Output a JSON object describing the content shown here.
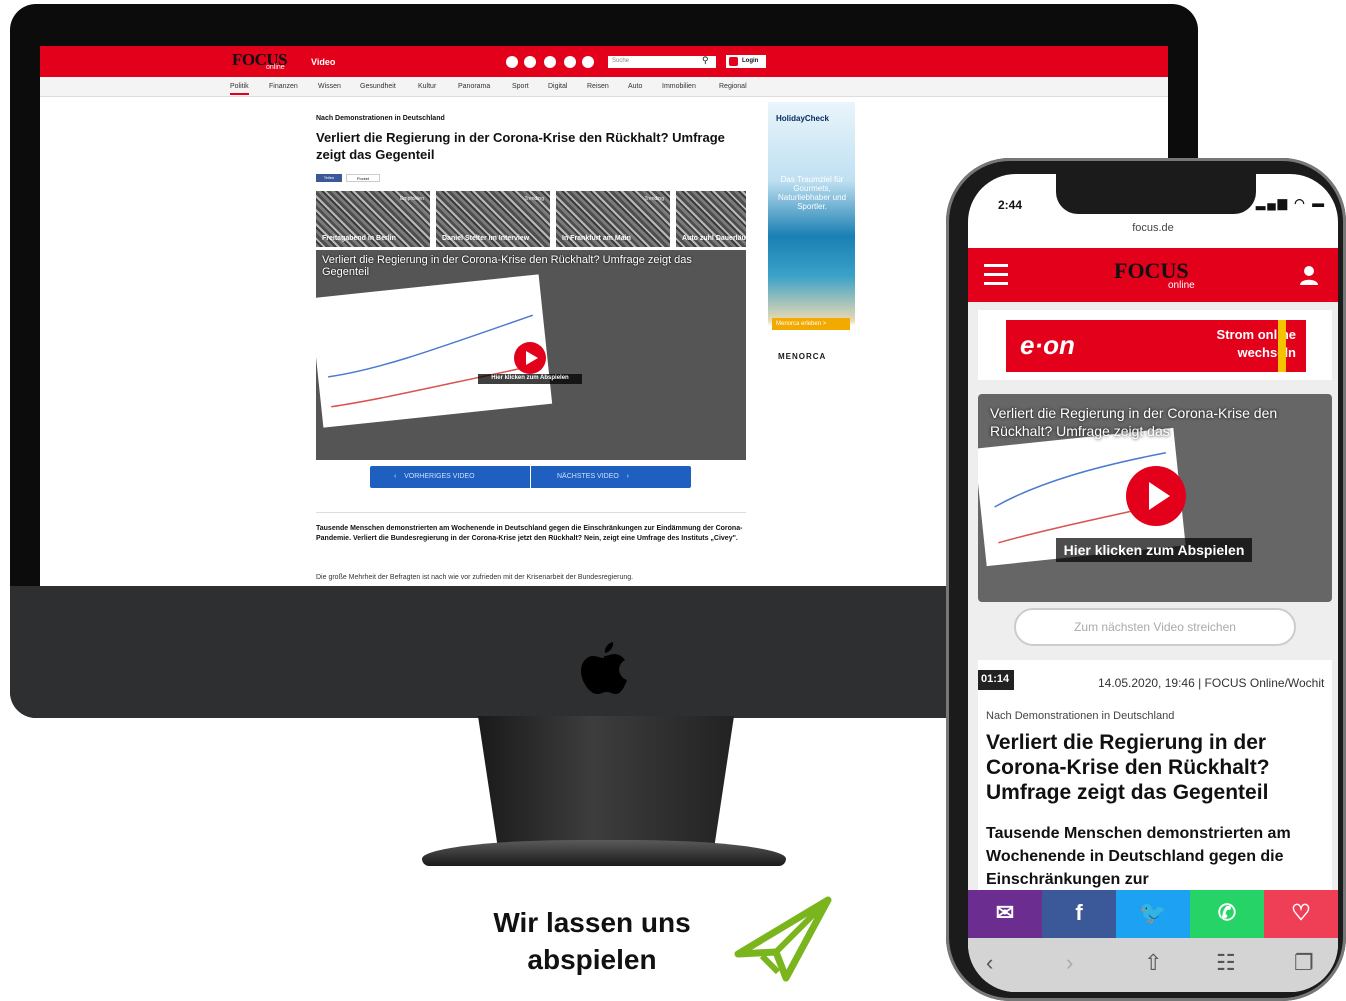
{
  "desktop": {
    "site": {
      "logo": "FOCUS",
      "logo_sub": "online",
      "section": "Video",
      "search_placeholder": "Suche",
      "login_label": "Login"
    },
    "nav": [
      "Politik",
      "Finanzen",
      "Wissen",
      "Gesundheit",
      "Kultur",
      "Panorama",
      "Sport",
      "Digital",
      "Reisen",
      "Auto",
      "Immobilien",
      "Regional"
    ],
    "article": {
      "overline": "Nach Demonstrationen in Deutschland",
      "headline": "Verliert die Regierung in der Corona-Krise den Rückhalt? Umfrage zeigt das Gegenteil",
      "share_label": "Teilen",
      "pocket_label": "Pocket",
      "teaser": "Tausende Menschen demonstrierten am Wochenende in Deutschland gegen die Einschränkungen zur Eindämmung der Corona-Pandemie. Verliert die Bundesregierung in der Corona-Krise jetzt den Rückhalt? Nein, zeigt eine Umfrage des Instituts „Civey\".",
      "body": "Die große Mehrheit der Befragten ist nach wie vor zufrieden mit der Krisenarbeit der Bundesregierung."
    },
    "thumbs": [
      {
        "tag": "Empfohlen",
        "label": "Freitagabend in Berlin"
      },
      {
        "tag": "Trending",
        "label": "Daniel Stelter im Interview"
      },
      {
        "tag": "Trending",
        "label": "In Frankfurt am Main"
      },
      {
        "tag": "",
        "label": "Auto zuhl Dauerläufer"
      }
    ],
    "video": {
      "title": "Verliert die Regierung in der Corona-Krise den Rückhalt? Umfrage zeigt das Gegenteil",
      "play_tip": "Hier klicken zum Abspielen",
      "prev_label": "VORHERIGES VIDEO",
      "next_label": "NÄCHSTES VIDEO"
    },
    "ad": {
      "brand": "HolidayCheck",
      "text": "Das Traumziel für Gourmets, Naturliebhaber und Sportler.",
      "cta": "Menorca erleben >",
      "sponsor": "MENORCA"
    }
  },
  "phone": {
    "time": "2:44",
    "url": "focus.de",
    "logo": "FOCUS",
    "logo_sub": "online",
    "ad": {
      "brand": "e·on",
      "text": "Strom online wechseln"
    },
    "video": {
      "title": "Verliert die Regierung in der Corona-Krise den Rückhalt? Umfrage zeigt das",
      "play_tip": "Hier klicken zum Abspielen",
      "next_swipe": "Zum nächsten Video streichen"
    },
    "card": {
      "duration": "01:14",
      "date_source": "14.05.2020, 19:46 | FOCUS Online/Wochit",
      "overline": "Nach Demonstrationen in Deutschland",
      "headline": "Verliert die Regierung in der Corona-Krise den Rückhalt? Umfrage zeigt das Gegenteil",
      "teaser": "Tausende Menschen demonstrierten am Wochenende in Deutschland gegen die Einschränkungen zur"
    },
    "share": [
      {
        "name": "email",
        "glyph": "✉",
        "color": "#6b2d8f"
      },
      {
        "name": "facebook",
        "glyph": "f",
        "color": "#3b5998"
      },
      {
        "name": "twitter",
        "glyph": "🐦",
        "color": "#1da1f2"
      },
      {
        "name": "whatsapp",
        "glyph": "✆",
        "color": "#25d366"
      },
      {
        "name": "pocket",
        "glyph": "♡",
        "color": "#ef3f56"
      }
    ]
  },
  "cta": {
    "line1": "Wir lassen uns",
    "line2": "abspielen"
  },
  "colors": {
    "brand_red": "#e2001a",
    "nav_blue": "#1e5fbf",
    "cta_green": "#7ab51d"
  }
}
